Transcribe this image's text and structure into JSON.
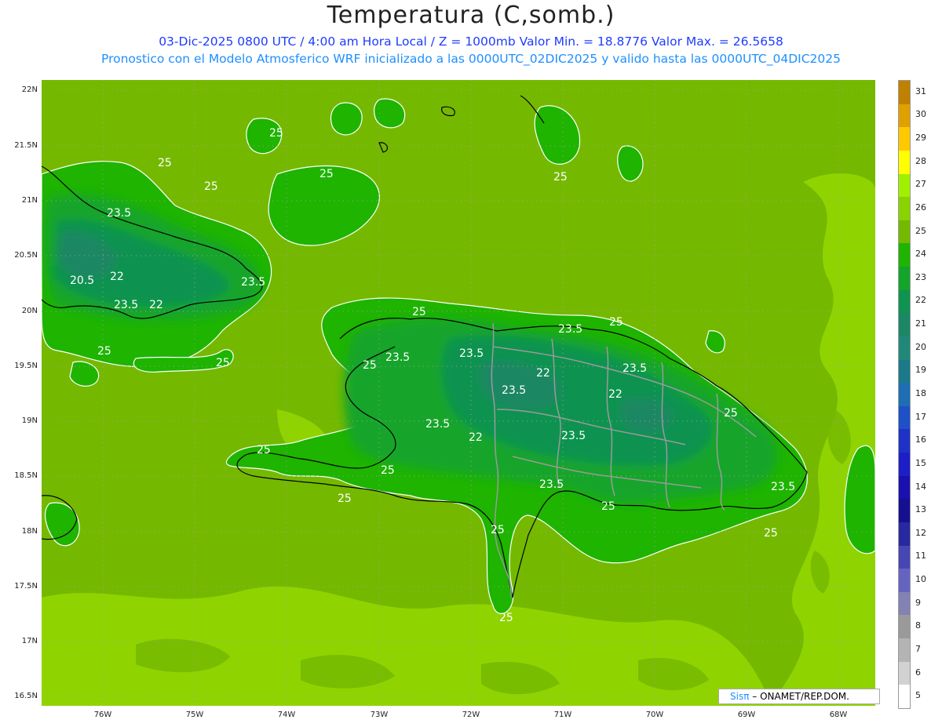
{
  "header": {
    "title": "Temperatura (C,somb.)",
    "line1": "03-Dic-2025  0800 UTC / 4:00 am Hora Local / Z = 1000mb   Valor Min. = 18.8776  Valor Max. = 26.5658",
    "line2": "Pronostico con el Modelo Atmosferico WRF inicializado a las 0000UTC_02DIC2025 y valido hasta las  0000UTC_04DIC2025"
  },
  "map": {
    "lat_ticks": [
      "22N",
      "21.5N",
      "21N",
      "20.5N",
      "20N",
      "19.5N",
      "19N",
      "18.5N",
      "18N",
      "17.5N",
      "17N",
      "16.5N"
    ],
    "lon_ticks": [
      "76W",
      "75W",
      "74W",
      "73W",
      "72W",
      "71W",
      "70W",
      "69W",
      "68W"
    ],
    "contour_labels": [
      "25",
      "25",
      "25",
      "25",
      "23.5",
      "20.5",
      "22",
      "23.5",
      "23.5",
      "22",
      "25",
      "25",
      "25",
      "25",
      "25",
      "23.5",
      "23.5",
      "25",
      "22",
      "23.5",
      "22",
      "23.5",
      "23.5",
      "25",
      "22",
      "23.5",
      "23.5",
      "25",
      "23.5",
      "25",
      "25",
      "25",
      "25",
      "25",
      "23.5",
      "25"
    ],
    "colors": {
      "ocean_27": "#8fd400",
      "ocean_26": "#74b900",
      "land_24": "#1eb400",
      "land_23": "#12a52a",
      "land_22": "#0e9350",
      "land_21": "#1b8764",
      "contour": "#ffffff",
      "coast": "#000000",
      "border": "#9a9a9a",
      "grid": "#9aa0a0"
    }
  },
  "colorbar": {
    "levels": [
      "31",
      "30",
      "29",
      "28",
      "27",
      "26",
      "25",
      "24",
      "23",
      "22",
      "21",
      "20",
      "19",
      "18",
      "17",
      "16",
      "15",
      "14",
      "13",
      "12",
      "11",
      "10",
      "9",
      "8",
      "7",
      "6",
      "5"
    ],
    "colors": [
      "#c08000",
      "#e0a000",
      "#ffc800",
      "#ffff00",
      "#a0f000",
      "#8ad200",
      "#74b900",
      "#1eb400",
      "#12a52a",
      "#0e9350",
      "#1b8764",
      "#208878",
      "#1a7a8a",
      "#1e6eb4",
      "#1e50c8",
      "#1e32c8",
      "#1e1ec8",
      "#1a10b0",
      "#141090",
      "#2828a0",
      "#4646b4",
      "#6464c0",
      "#8282b4",
      "#9a9a9a",
      "#b4b4b4",
      "#d2d2d2",
      "#ffffff"
    ]
  },
  "credit": {
    "brand": "Sisπ",
    "text": " – ONAMET/REP.DOM."
  }
}
